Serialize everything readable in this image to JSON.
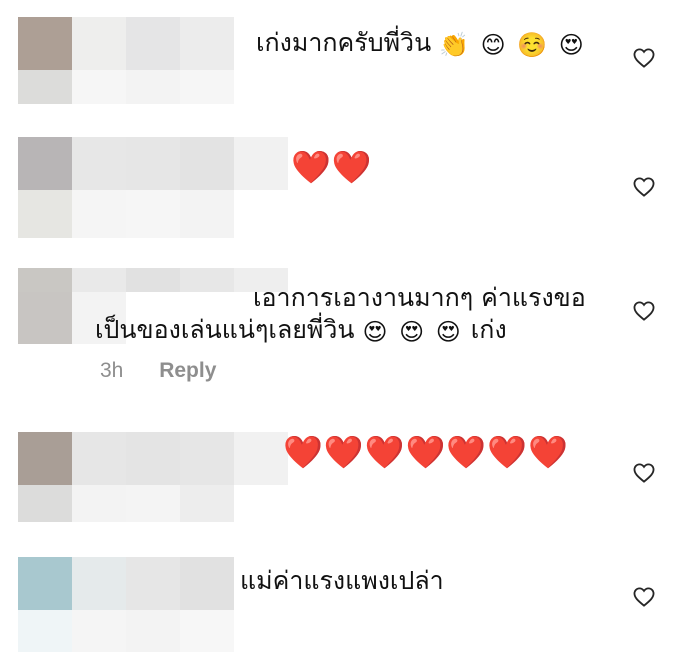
{
  "comments": [
    {
      "text": "เก่งมากครับพี่วิน",
      "emoji": "👏 😊 ☺️ 😍",
      "liked": false
    },
    {
      "text": "",
      "emoji": "❤️❤️",
      "liked": false
    },
    {
      "line1": "เอาการเอางานมากๆ ค่าแรงขอ",
      "line2": "เป็นของเล่นแน่ๆเลยพี่วิน",
      "emoji": "😍 😍 😍",
      "suffix": "เก่ง",
      "time": "3h",
      "reply_label": "Reply",
      "liked": false
    },
    {
      "text": "",
      "emoji": "❤️❤️❤️❤️❤️❤️❤️",
      "liked": false
    },
    {
      "text": "แม่ค่าแรงแพงเปล่า",
      "emoji": "",
      "liked": false
    }
  ],
  "icons": {
    "like": "heart-outline-icon"
  },
  "colors": {
    "text": "#111111",
    "meta": "#8e8e8e",
    "heart_red": "#e0243a",
    "like_outline": "#262626"
  }
}
